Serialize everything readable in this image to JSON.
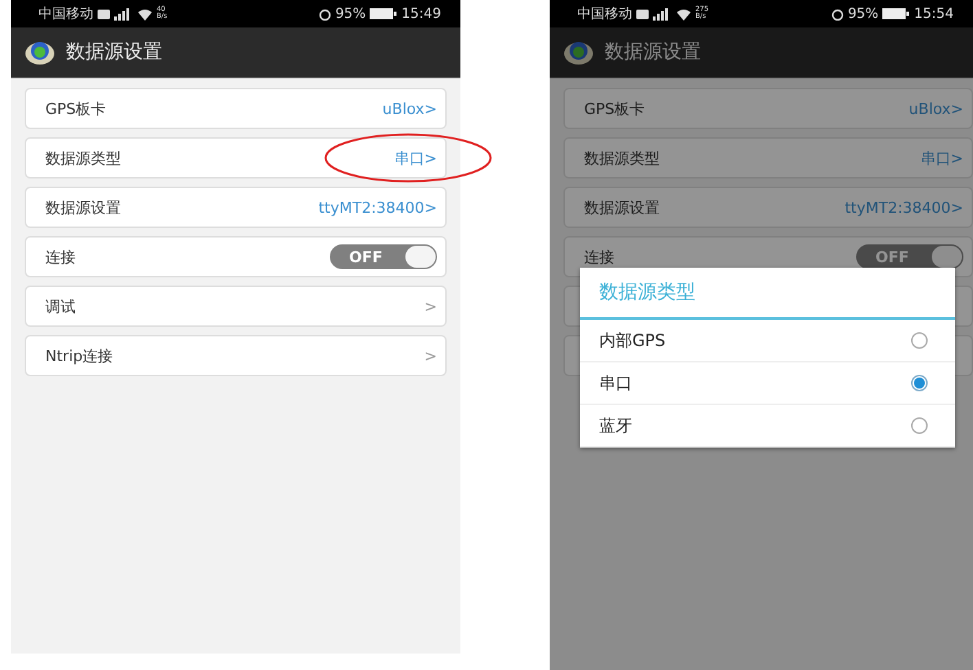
{
  "screens": [
    {
      "status_bar": {
        "carrier": "中国移动",
        "speed_value": "40",
        "speed_unit": "B/s",
        "battery": "95%",
        "time": "15:49"
      },
      "app_bar": {
        "title": "数据源设置"
      },
      "rows": [
        {
          "kind": "link",
          "label": "GPS板卡",
          "value": "uBlox>",
          "highlighted": false
        },
        {
          "kind": "link",
          "label": "数据源类型",
          "value": "串口>",
          "highlighted": true
        },
        {
          "kind": "link",
          "label": "数据源设置",
          "value": "ttyMT2:38400>"
        },
        {
          "kind": "toggle",
          "label": "连接",
          "on": false,
          "value": "OFF"
        },
        {
          "kind": "nav",
          "label": "调试",
          "value": ">"
        },
        {
          "kind": "nav",
          "label": "Ntrip连接",
          "value": ">"
        }
      ]
    },
    {
      "status_bar": {
        "carrier": "中国移动",
        "speed_value": "275",
        "speed_unit": "B/s",
        "battery": "95%",
        "time": "15:54"
      },
      "app_bar": {
        "title": "数据源设置"
      },
      "rows": [
        {
          "kind": "link",
          "label": "GPS板卡",
          "value": "uBlox>"
        },
        {
          "kind": "link",
          "label": "数据源类型",
          "value": "串口>"
        },
        {
          "kind": "link",
          "label": "数据源设置",
          "value": "ttyMT2:38400>"
        },
        {
          "kind": "toggle",
          "label": "连接",
          "on": false,
          "value": "OFF"
        },
        {
          "kind": "blank"
        },
        {
          "kind": "blank"
        }
      ],
      "dialog": {
        "title": "数据源类型",
        "options": [
          {
            "label": "内部GPS",
            "selected": false
          },
          {
            "label": "串口",
            "selected": true
          },
          {
            "label": "蓝牙",
            "selected": false
          }
        ]
      }
    }
  ]
}
